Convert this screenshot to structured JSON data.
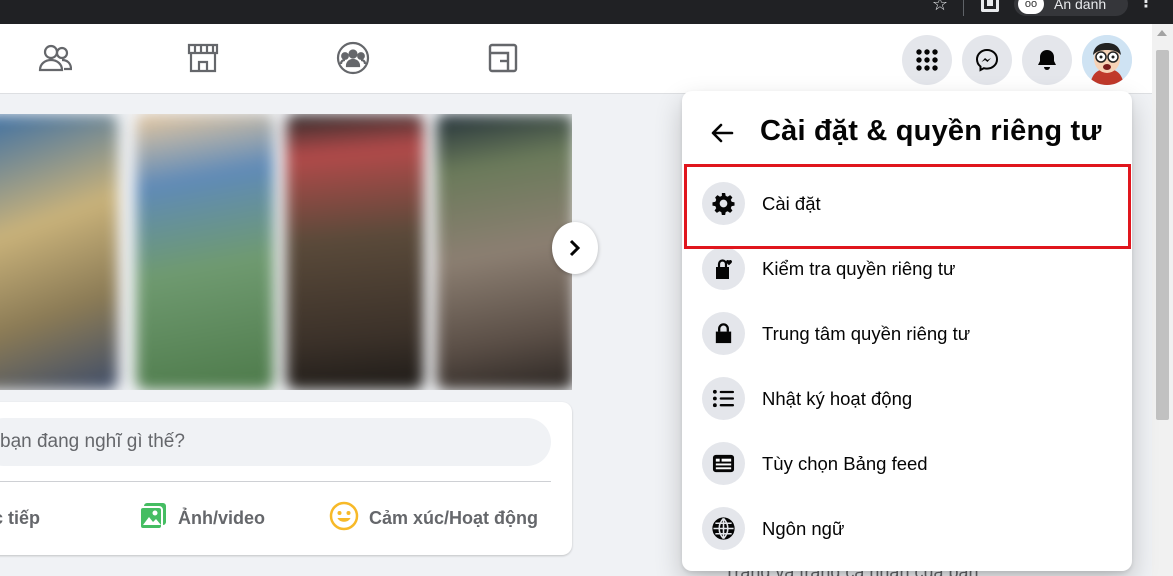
{
  "browser": {
    "profile_name": "Ẩn danh",
    "colors": {
      "chrome_bg": "#202124",
      "profile_pill": "#35363a"
    }
  },
  "header": {
    "nav_tabs": [
      {
        "name": "friends",
        "icon": "friends-icon"
      },
      {
        "name": "marketplace",
        "icon": "marketplace-icon"
      },
      {
        "name": "groups",
        "icon": "groups-icon"
      },
      {
        "name": "gaming",
        "icon": "gaming-icon"
      }
    ],
    "right_buttons": [
      {
        "name": "menu",
        "icon": "grid-menu-icon"
      },
      {
        "name": "messenger",
        "icon": "messenger-icon"
      },
      {
        "name": "notifications",
        "icon": "bell-icon"
      }
    ],
    "profile_avatar": "avatar-icon"
  },
  "composer": {
    "placeholder": "bạn đang nghĩ gì thế?",
    "actions": [
      {
        "label": "ực tiếp",
        "icon": "live-video-icon"
      },
      {
        "label": "Ảnh/video",
        "icon": "photo-video-icon",
        "color": "#45bd62"
      },
      {
        "label": "Cảm xúc/Hoạt động",
        "icon": "feeling-icon",
        "color": "#f7b928"
      }
    ]
  },
  "menu": {
    "title": "Cài đặt & quyền riêng tư",
    "items": [
      {
        "label": "Cài đặt",
        "icon": "gear-icon",
        "highlighted": true
      },
      {
        "label": "Kiểm tra quyền riêng tư",
        "icon": "lock-heart-icon"
      },
      {
        "label": "Trung tâm quyền riêng tư",
        "icon": "lock-icon"
      },
      {
        "label": "Nhật ký hoạt động",
        "icon": "list-icon"
      },
      {
        "label": "Tùy chọn Bảng feed",
        "icon": "feed-icon"
      },
      {
        "label": "Ngôn ngữ",
        "icon": "globe-icon"
      }
    ],
    "highlight_color": "#e0161d"
  },
  "background_text": "Trang và trang cá nhân của bạn"
}
